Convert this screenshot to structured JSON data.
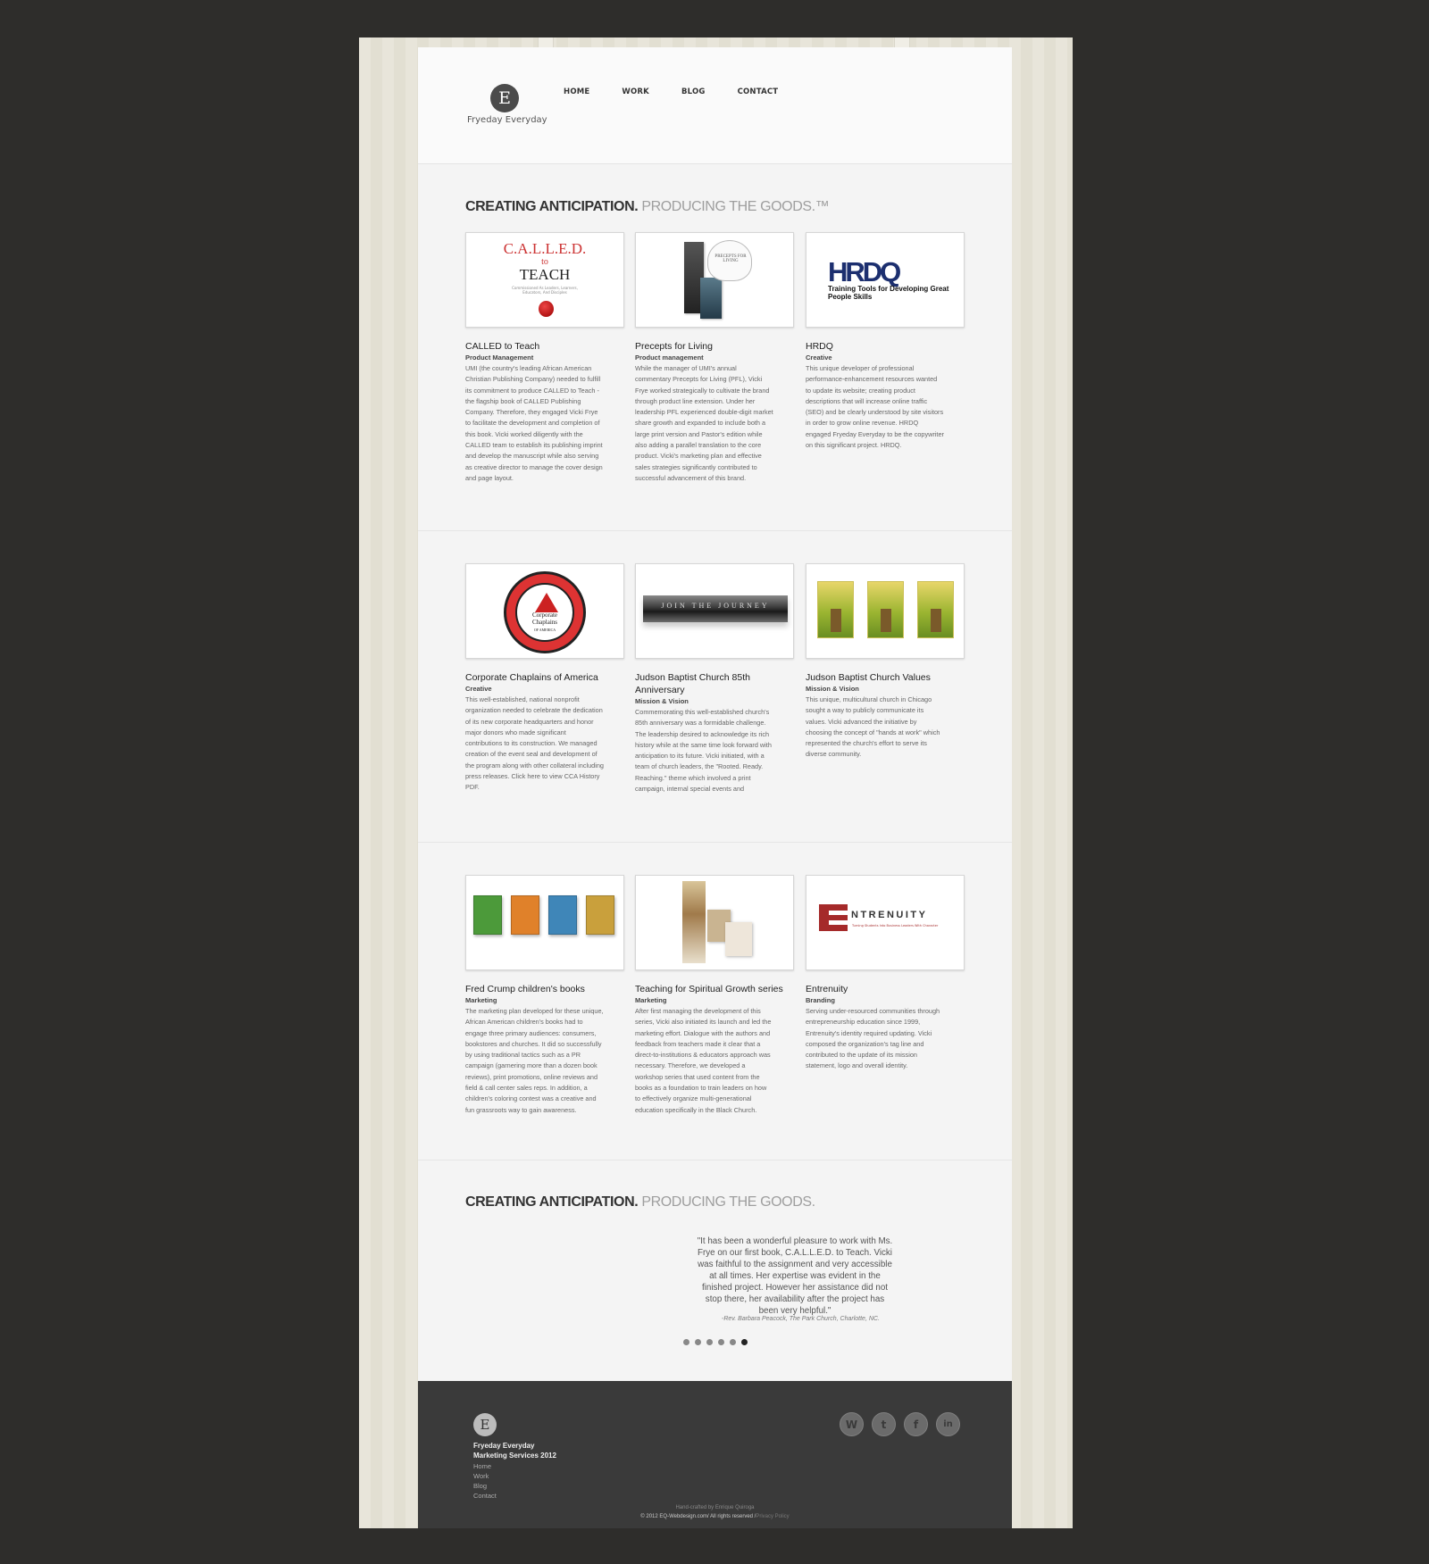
{
  "brand": {
    "name": "Fryeday Everyday",
    "mark": "E"
  },
  "nav": [
    "HOME",
    "WORK",
    "BLOG",
    "CONTACT"
  ],
  "headline": {
    "dark": "CREATING ANTICIPATION.",
    "light": "PRODUCING THE GOODS.™"
  },
  "projects": [
    {
      "title": "CALLED to Teach",
      "category": "Product Management",
      "description": "UMI (the country's leading African American Christian Publishing Company) needed to fulfill its commitment to produce CALLED to Teach - the flagship book of CALLED Publishing Company. Therefore, they engaged Vicki Frye to facilitate the development and completion of this book. Vicki worked diligently with the CALLED team to establish its publishing imprint and develop the manuscript while also serving as creative director to manage the cover design and page layout.",
      "thumb": {
        "line1": "C.A.L.L.E.D.",
        "line2": "to",
        "line3": "TEACH",
        "line4": "Commissioned As Leaders, Learners, Educators, And Disciples"
      }
    },
    {
      "title": "Precepts for Living",
      "category": "Product management",
      "description": "While the manager of UMI's annual commentary Precepts for Living (PFL), Vicki Frye worked strategically to cultivate the brand through product line extension. Under her leadership PFL experienced double-digit market share growth and expanded to include both a large print version and Pastor's edition while also adding a parallel translation to the core product. Vicki's marketing plan and effective sales strategies significantly contributed to successful advancement of this brand.",
      "thumb": {
        "label": "PRECEPTS FOR LIVING"
      }
    },
    {
      "title": "HRDQ",
      "category": "Creative",
      "description": "This unique developer of professional performance-enhancement resources wanted to update its website; creating product descriptions that will increase online traffic (SEO) and be clearly understood by site visitors in order to grow online revenue. HRDQ engaged Fryeday Everyday to be the copywriter on this significant project. HRDQ.",
      "thumb": {
        "logo": "HRDQ",
        "tag": "Training Tools for Developing Great People Skills"
      }
    },
    {
      "title": "Corporate Chaplains of America",
      "category": "Creative",
      "description": "This well-established, national nonprofit organization needed to celebrate the dedication of its new corporate headquarters and honor major donors who made significant contributions to its construction. We managed creation of the event seal and development of the program along with other collateral including press releases. Click here to view CCA History PDF.",
      "thumb": {
        "label": "Corporate Chaplains",
        "sub": "OF AMERICA"
      }
    },
    {
      "title": "Judson Baptist Church 85th Anniversary",
      "category": "Mission & Vision",
      "description": "Commemorating this well-established church's 85th anniversary was a formidable challenge. The leadership desired to acknowledge its rich history while at the same time look forward with anticipation to its future. Vicki initiated, with a team of church leaders, the \"Rooted. Ready. Reaching.\" theme which involved a print campaign, internal special events and",
      "thumb": {
        "label": "JOIN THE JOURNEY"
      }
    },
    {
      "title": "Judson Baptist Church Values",
      "category": "Mission & Vision",
      "description": "This unique, multicultural church in Chicago sought a way to publicly communicate its values. Vicki advanced the initiative by choosing the concept of \"hands at work\" which represented the church's effort to serve its diverse community.",
      "thumb": {
        "label": ""
      }
    },
    {
      "title": "Fred Crump children's books",
      "category": "Marketing",
      "description": "The marketing plan developed for these unique, African American children's books had to engage three primary audiences: consumers, bookstores and churches. It did so successfully by using traditional tactics such as a PR campaign (garnering more than a dozen book reviews), print promotions, online reviews and field & call center sales reps. In addition, a children's coloring contest was a creative and fun grassroots way to gain awareness.",
      "thumb": {
        "colors": [
          "#4c9a3a",
          "#e0812a",
          "#3f86b8",
          "#c9a03c"
        ]
      }
    },
    {
      "title": "Teaching for Spiritual Growth series",
      "category": "Marketing",
      "description": "After first managing the development of this series, Vicki also initiated its launch and led the marketing effort. Dialogue with the authors and feedback from teachers made it clear that a direct-to-institutions & educators approach was necessary. Therefore, we developed a workshop series that used content from the books as a foundation to train leaders on how to effectively organize multi-generational education specifically in the Black Church.",
      "thumb": {
        "label": ""
      }
    },
    {
      "title": "Entrenuity",
      "category": "Branding",
      "description": "Serving under-resourced communities through entrepreneurship education since 1999, Entrenuity's identity required updating. Vicki composed the organization's tag line and contributed to the update of its mission statement, logo and overall identity.",
      "thumb": {
        "name": "NTRENUITY",
        "tag": "Turning Students Into Business Leaders With Character"
      }
    }
  ],
  "testimonial": {
    "headline_dark": "CREATING ANTICIPATION.",
    "headline_light": "PRODUCING THE GOODS.",
    "quote": "\"It has been a wonderful pleasure to work with Ms. Frye on our first book, C.A.L.L.E.D. to Teach. Vicki was faithful to the assignment and very accessible at all times. Her expertise was evident in the finished project. However her assistance did not stop there, her availability after the project has been very helpful.\"",
    "author": "-Rev. Barbara Peacock, The Park Church, Charlotte, NC.",
    "dots": 6,
    "active_dot": 5
  },
  "footer": {
    "company_line1": "Fryeday Everyday",
    "company_line2": "Marketing Services 2012",
    "links": [
      "Home",
      "Work",
      "Blog",
      "Contact"
    ],
    "social": [
      {
        "icon": "wordpress-icon",
        "glyph": "W"
      },
      {
        "icon": "twitter-icon",
        "glyph": "t"
      },
      {
        "icon": "facebook-icon",
        "glyph": "f"
      },
      {
        "icon": "linkedin-icon",
        "glyph": "in"
      }
    ],
    "credit": "Hand-crafted by Enrique Quiroga",
    "copyright": "© 2012 EQ-Webdesign.com/ All rights reserved /",
    "privacy": "Privacy Policy"
  }
}
